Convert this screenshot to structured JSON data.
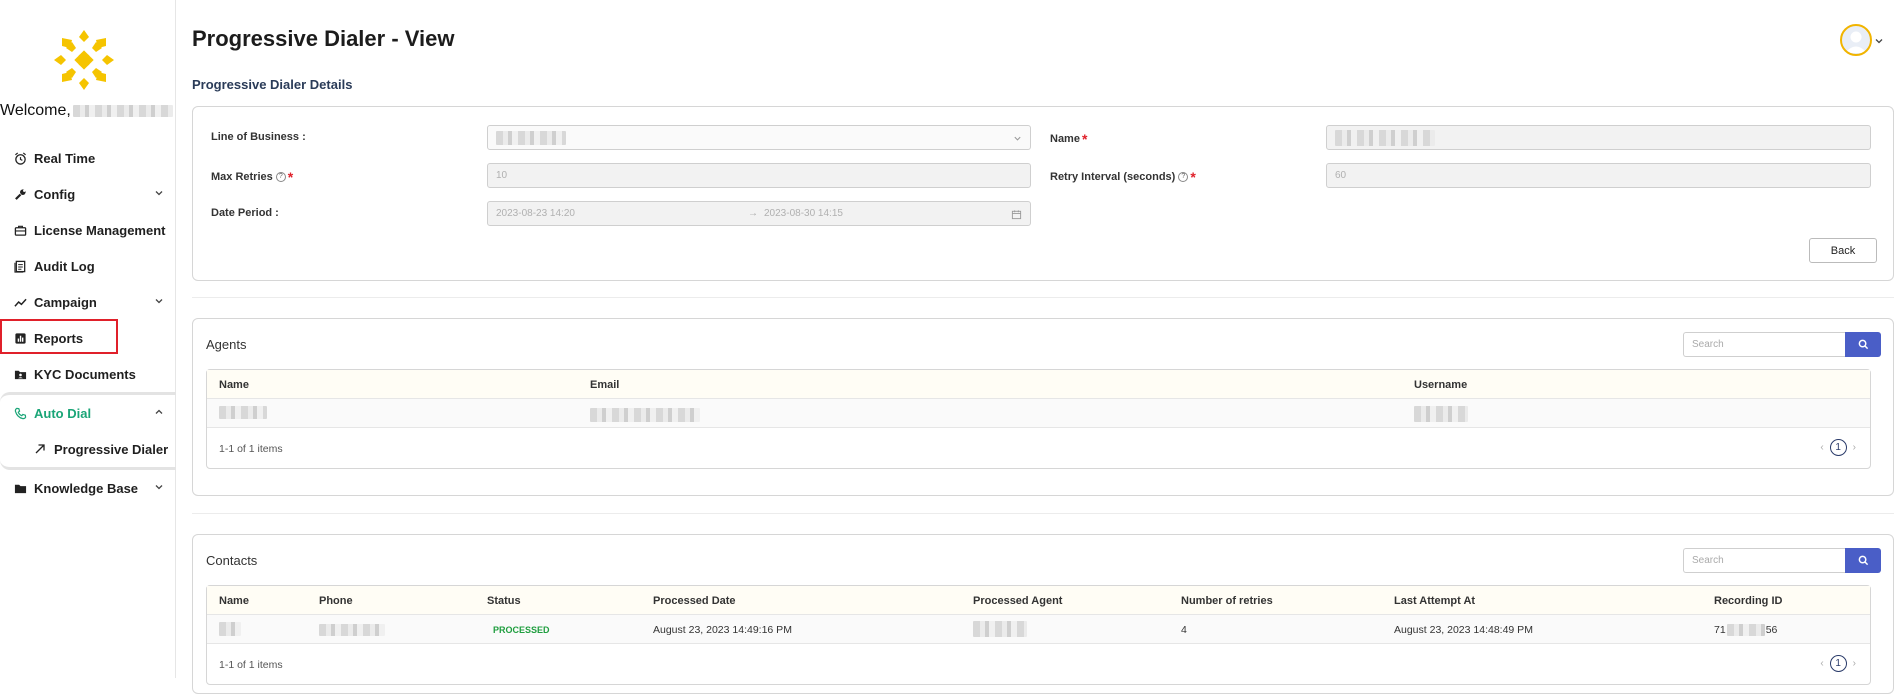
{
  "sidebar": {
    "welcome_label": "Welcome,",
    "items": [
      {
        "label": "Real Time",
        "icon": "alarm-clock-icon"
      },
      {
        "label": "Config",
        "icon": "wrench-icon",
        "expandable": true
      },
      {
        "label": "License Management",
        "icon": "briefcase-icon"
      },
      {
        "label": "Audit Log",
        "icon": "book-icon"
      },
      {
        "label": "Campaign",
        "icon": "trend-line-icon",
        "expandable": true
      },
      {
        "label": "Reports",
        "icon": "bar-chart-icon"
      },
      {
        "label": "KYC Documents",
        "icon": "id-card-icon"
      },
      {
        "label": "Auto Dial",
        "icon": "phone-icon",
        "expanded": true
      },
      {
        "label": "Progressive Dialer",
        "icon": "arrow-up-right-icon"
      },
      {
        "label": "Knowledge Base",
        "icon": "folder-icon",
        "expandable": true
      }
    ]
  },
  "header": {
    "title": "Progressive Dialer - View"
  },
  "details": {
    "section_title": "Progressive Dialer Details",
    "line_of_business_label": "Line of Business :",
    "name_label": "Name",
    "max_retries_label": "Max Retries",
    "max_retries_value": "10",
    "retry_interval_label": "Retry Interval (seconds)",
    "retry_interval_value": "60",
    "date_period_label": "Date Period :",
    "date_start": "2023-08-23 14:20",
    "date_end": "2023-08-30 14:15",
    "back_label": "Back"
  },
  "agents": {
    "title": "Agents",
    "search_placeholder": "Search",
    "columns": [
      "Name",
      "Email",
      "Username"
    ],
    "count_text": "1-1 of 1 items",
    "page": "1"
  },
  "contacts": {
    "title": "Contacts",
    "search_placeholder": "Search",
    "columns": [
      "Name",
      "Phone",
      "Status",
      "Processed Date",
      "Processed Agent",
      "Number of retries",
      "Last Attempt At",
      "Recording ID"
    ],
    "rows": [
      {
        "status": "PROCESSED",
        "processed_date": "August 23, 2023 14:49:16 PM",
        "retries": "4",
        "last_attempt": "August 23, 2023 14:48:49 PM",
        "recording_prefix": "71",
        "recording_suffix": "56"
      }
    ],
    "count_text": "1-1 of 1 items",
    "page": "1"
  },
  "colors": {
    "accent_green": "#1aa577",
    "search_button": "#4a5ec7",
    "required": "#e0202a",
    "logo": "#f5c400",
    "highlight_box": "#e0202a"
  }
}
